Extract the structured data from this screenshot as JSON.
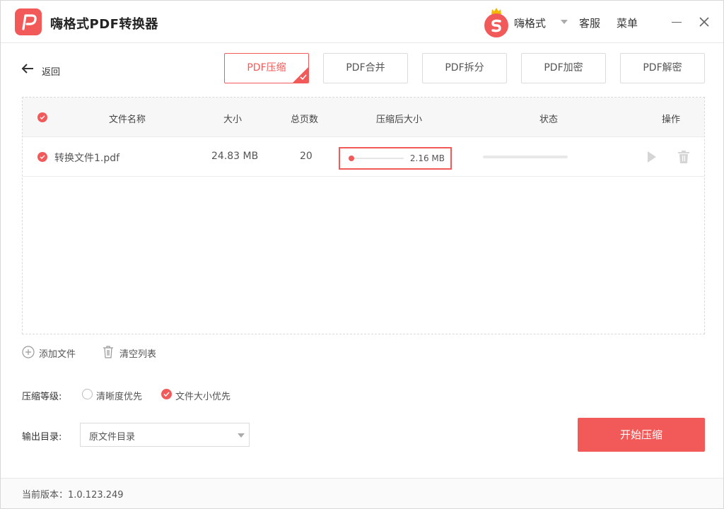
{
  "app": {
    "title": "嗨格式PDF转换器",
    "accent": "#f25a5a"
  },
  "titlebar": {
    "brand_name": "嗨格式",
    "customer_service": "客服",
    "menu": "菜单",
    "icons": [
      "app-logo",
      "brand-avatar-icon",
      "dropdown-caret",
      "minimize-icon",
      "close-icon"
    ]
  },
  "toolbar": {
    "back_label": "返回",
    "tabs": [
      {
        "label": "PDF压缩",
        "active": true
      },
      {
        "label": "PDF合并",
        "active": false
      },
      {
        "label": "PDF拆分",
        "active": false
      },
      {
        "label": "PDF加密",
        "active": false
      },
      {
        "label": "PDF解密",
        "active": false
      }
    ]
  },
  "table": {
    "headers": {
      "name": "文件名称",
      "size": "大小",
      "pages": "总页数",
      "compressed_size": "压缩后大小",
      "status": "状态",
      "actions": "操作"
    },
    "rows": [
      {
        "checked": true,
        "name": "转换文件1.pdf",
        "size": "24.83 MB",
        "pages": "20",
        "compressed_size": "2.16 MB",
        "compression_level": 0.0,
        "status_progress": 0
      }
    ]
  },
  "actions": {
    "add_file": "添加文件",
    "clear_list": "清空列表"
  },
  "compression": {
    "label": "压缩等级:",
    "options": [
      {
        "label": "清晰度优先",
        "selected": false
      },
      {
        "label": "文件大小优先",
        "selected": true
      }
    ]
  },
  "output": {
    "label": "输出目录:",
    "value": "原文件目录"
  },
  "start_button": "开始压缩",
  "footer": {
    "version_text": "当前版本：1.0.123.249"
  }
}
